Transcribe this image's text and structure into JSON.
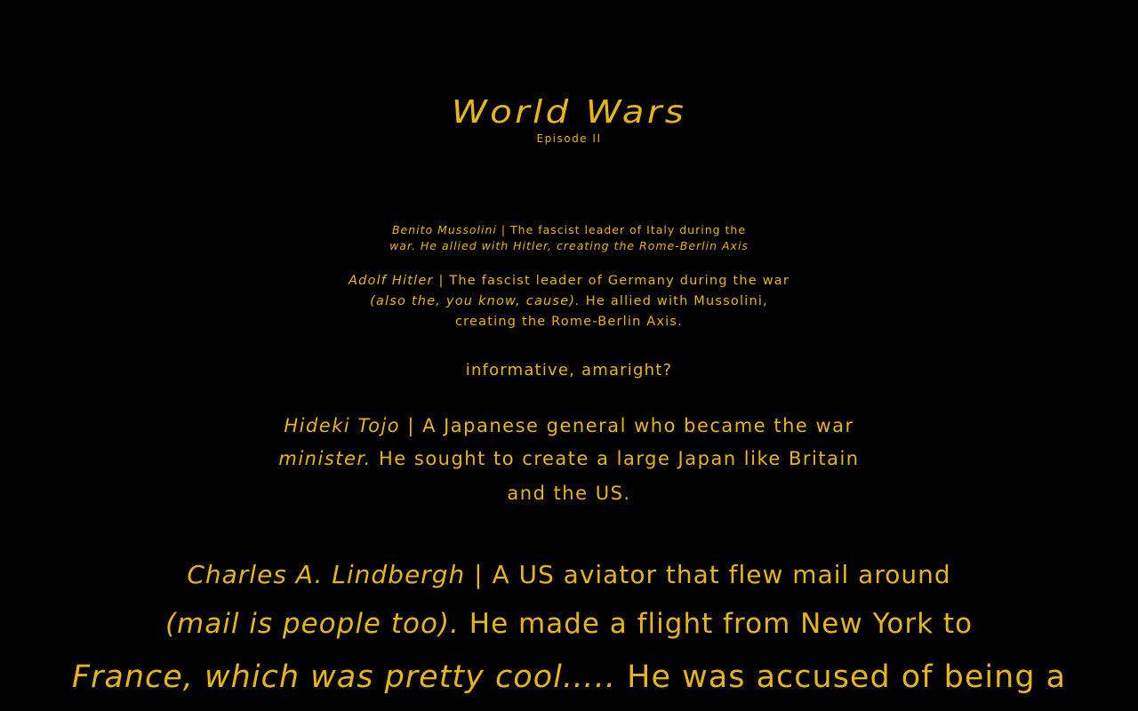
{
  "crawl": {
    "title": "World Wars",
    "subtitle": "Episode II",
    "mussolini": {
      "line1_name": "Benito Mussolini",
      "line1_rest": " | The fascist leader of Italy during the",
      "line2_italic": "war.  He allied with Hitler, creating the Rome-Berlin Axis"
    },
    "hitler": {
      "line1_name": "Adolf Hitler",
      "line1_rest": " | The fascist leader of Germany during the war",
      "line2_italic": "(also the, you know, cause).",
      "line2_rest": "  He allied with Mussolini,",
      "line3": "creating the Rome-Berlin Axis."
    },
    "aside": "informative, amaright?",
    "tojo": {
      "line1_name": "Hideki Tojo",
      "line1_rest": " | A Japanese general who became the war",
      "line2_italic": "minister.",
      "line2_rest": "  He sought to create a large Japan like Britain",
      "line3": "and the US."
    },
    "lindbergh": {
      "line1_name": "Charles A. Lindbergh",
      "line1_rest": " | A US aviator that flew mail around",
      "line2_italic": "(mail is people too).",
      "line2_rest": "  He made a flight from New York to",
      "line3_italic": "France, which was pretty cool…..",
      "line3_rest": "  He was accused of being a"
    }
  },
  "colors": {
    "background": "#000000",
    "text": "#e8b41c"
  }
}
